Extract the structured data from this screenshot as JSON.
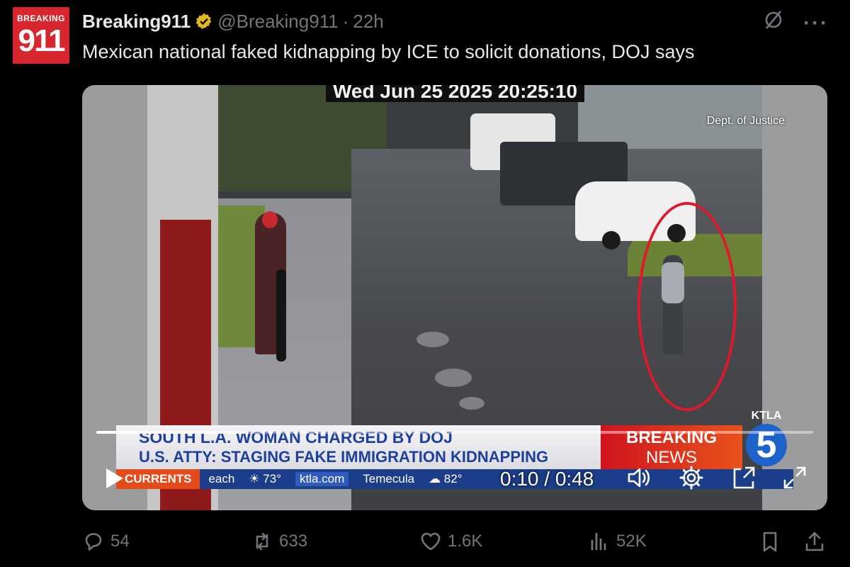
{
  "account": {
    "avatar_small": "BREAKING",
    "avatar_big": "911",
    "display_name": "Breaking911",
    "handle": "@Breaking911",
    "separator": "·",
    "time": "22h"
  },
  "tweet": {
    "text": "Mexican national faked kidnapping by ICE to solicit donations, DOJ says"
  },
  "header_icons": [
    "grok-icon",
    "more-icon"
  ],
  "video": {
    "overlay_timestamp": "Wed Jun 25 2025  20:25:10",
    "credit": "Dept. of Justice",
    "lower_third": {
      "headline": "SOUTH L.A. WOMAN CHARGED BY DOJ",
      "subheadline": "U.S. ATTY: STAGING FAKE IMMIGRATION KIDNAPPING",
      "breaking_1": "BREAKING",
      "breaking_2": "NEWS",
      "station": "KTLA",
      "channel": "5",
      "ticker_label": "CURRENTS",
      "ticker_items": [
        "each",
        "☀ 73°",
        "ktla.com",
        "Temecula",
        "☁ 82°"
      ]
    },
    "player": {
      "current_time": "0:10",
      "duration": "0:48",
      "time_display": "0:10 / 0:48",
      "progress": 0.208
    }
  },
  "engagement": {
    "replies": "54",
    "reposts": "633",
    "likes": "1.6K",
    "views": "52K"
  }
}
